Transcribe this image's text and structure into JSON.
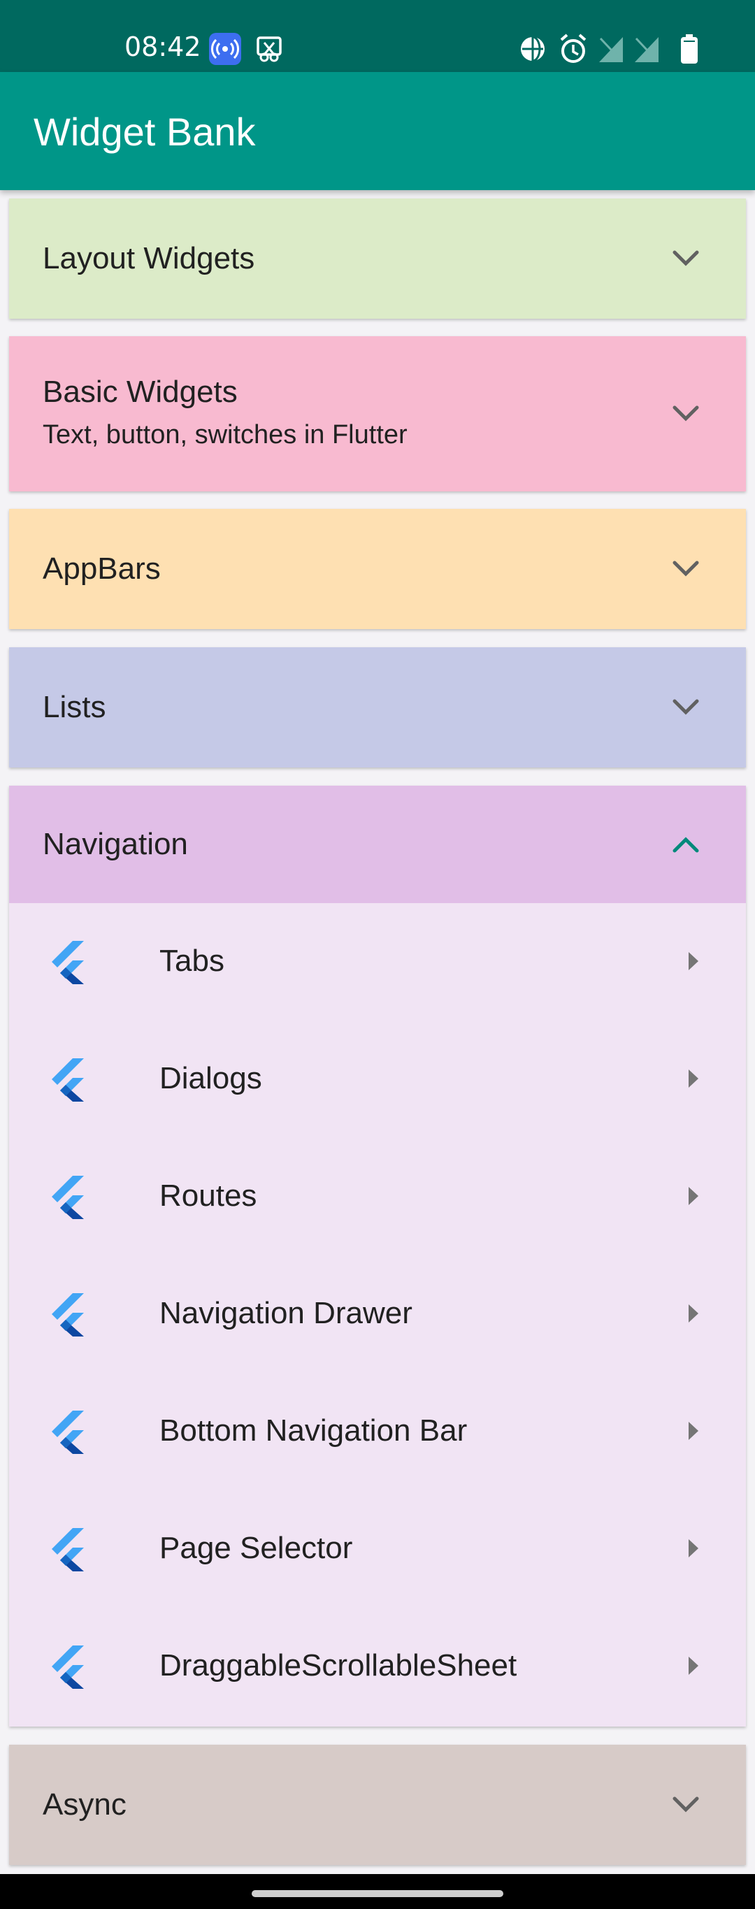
{
  "status_bar": {
    "time": "08:42",
    "icons_left": [
      "hotspot-icon",
      "screenshot-icon"
    ],
    "icons_right": [
      "vpn-icon",
      "alarm-icon",
      "signal-off-icon",
      "signal-off-icon",
      "battery-icon"
    ]
  },
  "app_bar": {
    "title": "Widget Bank"
  },
  "categories": [
    {
      "title": "Layout Widgets",
      "subtitle": "",
      "color": "#dcebc8",
      "expanded": false
    },
    {
      "title": "Basic Widgets",
      "subtitle": "Text, button, switches in Flutter",
      "color": "#f8bad0",
      "expanded": false
    },
    {
      "title": "AppBars",
      "subtitle": "",
      "color": "#fee0b2",
      "expanded": false
    },
    {
      "title": "Lists",
      "subtitle": "",
      "color": "#c5c9e7",
      "expanded": false
    },
    {
      "title": "Navigation",
      "subtitle": "",
      "color": "#e1bee7",
      "body_color": "#f1e4f4",
      "expanded": true,
      "items": [
        {
          "label": "Tabs",
          "icon": "flutter-logo-icon"
        },
        {
          "label": "Dialogs",
          "icon": "flutter-logo-icon"
        },
        {
          "label": "Routes",
          "icon": "flutter-logo-icon"
        },
        {
          "label": "Navigation Drawer",
          "icon": "flutter-logo-icon"
        },
        {
          "label": "Bottom Navigation Bar",
          "icon": "flutter-logo-icon"
        },
        {
          "label": "Page Selector",
          "icon": "flutter-logo-icon"
        },
        {
          "label": "DraggableScrollableSheet",
          "icon": "flutter-logo-icon"
        }
      ]
    },
    {
      "title": "Async",
      "subtitle": "",
      "color": "#d7cbc8",
      "expanded": false
    }
  ],
  "colors": {
    "status_bar": "#00695f",
    "app_bar": "#009688",
    "accent": "#00897b",
    "chevron": "#616161"
  }
}
